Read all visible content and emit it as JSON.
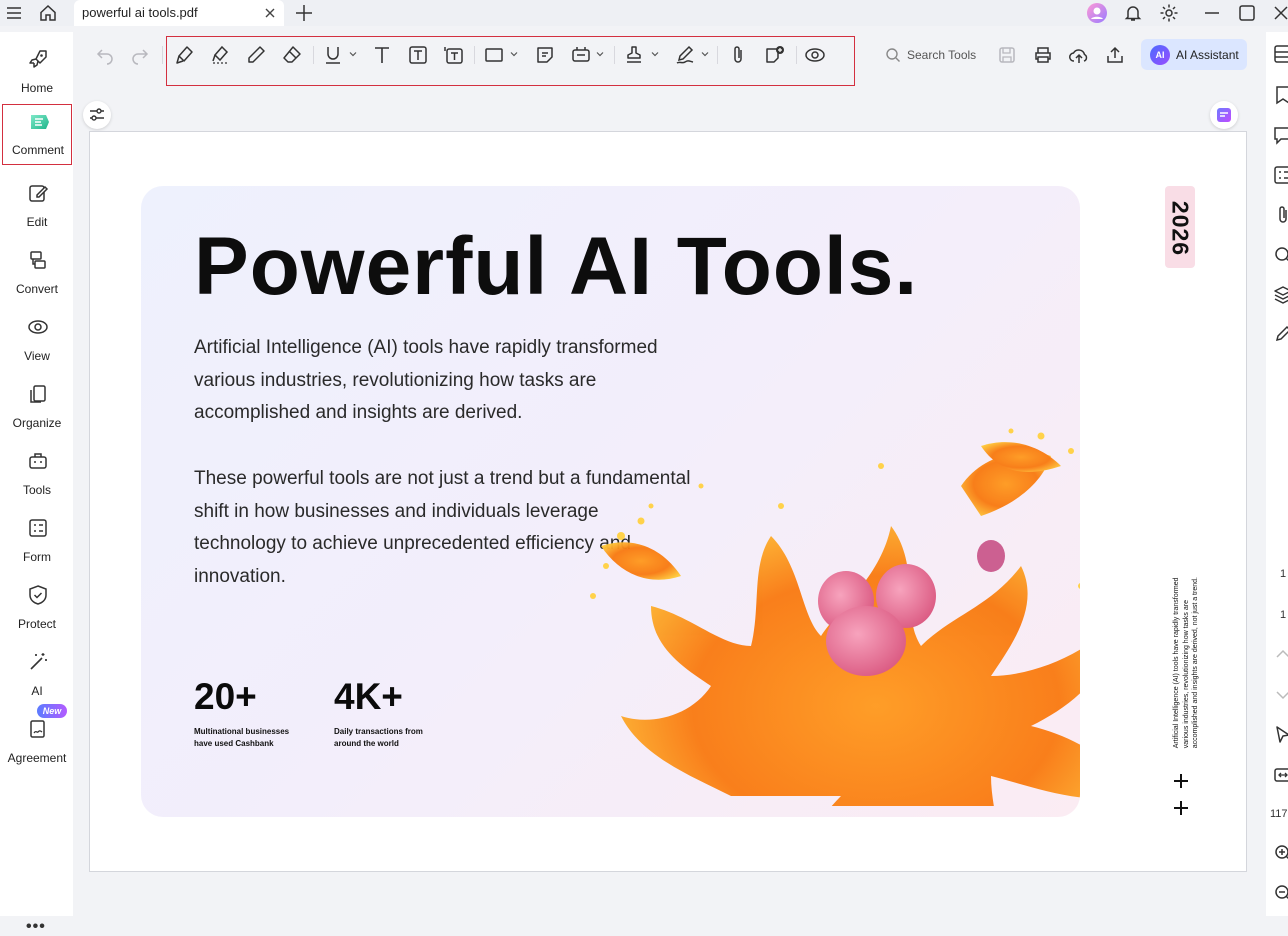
{
  "window": {
    "tab_title": "powerful ai tools.pdf"
  },
  "sidebar": {
    "items": [
      {
        "label": "Home",
        "icon": "rocket-icon"
      },
      {
        "label": "Comment",
        "icon": "comment-icon",
        "active": true
      },
      {
        "label": "Edit",
        "icon": "edit-icon"
      },
      {
        "label": "Convert",
        "icon": "convert-icon"
      },
      {
        "label": "View",
        "icon": "view-icon"
      },
      {
        "label": "Organize",
        "icon": "organize-icon"
      },
      {
        "label": "Tools",
        "icon": "toolbox-icon"
      },
      {
        "label": "Form",
        "icon": "form-icon"
      },
      {
        "label": "Protect",
        "icon": "shield-icon"
      },
      {
        "label": "AI",
        "icon": "magic-wand-icon"
      },
      {
        "label": "Agreement",
        "icon": "agreement-icon"
      }
    ],
    "new_badge": "New",
    "more": "•••"
  },
  "toolbar": {
    "search_label": "Search Tools",
    "ai_badge": "AI",
    "ai_label": "AI Assistant"
  },
  "right_panel": {
    "page_labels": [
      "1",
      "1"
    ],
    "zoom_value": "117"
  },
  "document": {
    "headline": "Powerful AI Tools.",
    "paragraph1": "Artificial Intelligence (AI) tools have rapidly transformed various industries, revolutionizing how tasks are accomplished and insights are derived.",
    "paragraph2": "These powerful tools are not just a trend but a fundamental shift in how businesses and individuals leverage technology to achieve unprecedented efficiency and innovation.",
    "stats": [
      {
        "value": "20+",
        "caption": "Multinational businesses have used Cashbank"
      },
      {
        "value": "4K+",
        "caption": "Daily transactions from around the world"
      }
    ],
    "year": "2026",
    "side_caption": "Artificial Intelligence (AI) tools have rapidly transformed various industries, revolutionizing how tasks are accomplished and insights are derived, not just a trend."
  },
  "colors": {
    "accent": "#d32f3f",
    "ai_button_bg": "#dbe6ff",
    "comment_icon": "#2fc59b"
  }
}
